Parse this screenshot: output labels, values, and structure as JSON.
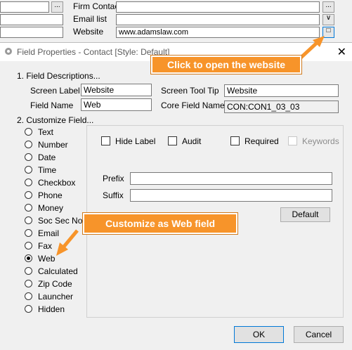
{
  "background_form": {
    "firm_contact_label": "Firm Contact",
    "email_list_label": "Email list",
    "website_label": "Website",
    "website_value": "www.adamslaw.com",
    "lookup_button": "...",
    "dropdown_glyph": "∨",
    "open_glyph": "□"
  },
  "dialog": {
    "title": "Field Properties - Contact [Style: Default]",
    "close_glyph": "✕",
    "section1": "1. Field Descriptions...",
    "section1_underline": "1",
    "screen_label_label": "Screen Label",
    "screen_label_value": "Website",
    "screen_tooltip_label": "Screen Tool Tip",
    "screen_tooltip_value": "Website",
    "field_name_label": "Field Name",
    "field_name_value": "Web",
    "core_field_name_label": "Core Field Name",
    "core_field_name_value": "CON:CON1_03_03",
    "section2": "2. Customize Field...",
    "field_types": [
      "Text",
      "Number",
      "Date",
      "Time",
      "Checkbox",
      "Phone",
      "Money",
      "Soc Sec No.",
      "Email",
      "Fax",
      "Web",
      "Calculated",
      "Zip Code",
      "Launcher",
      "Hidden"
    ],
    "selected_type": "Web",
    "checkboxes": {
      "hide_label": "Hide Label",
      "audit": "Audit",
      "required": "Required",
      "keywords": "Keywords"
    },
    "prefix_label": "Prefix",
    "suffix_label": "Suffix",
    "default_button": "Default",
    "ok_button": "OK",
    "cancel_button": "Cancel"
  },
  "callouts": {
    "open_website": "Click to open the website",
    "customize_web": "Customize as Web field"
  },
  "colors": {
    "callout": "#f7942a",
    "arrow": "#f7942a",
    "focus_border": "#0078d7"
  }
}
